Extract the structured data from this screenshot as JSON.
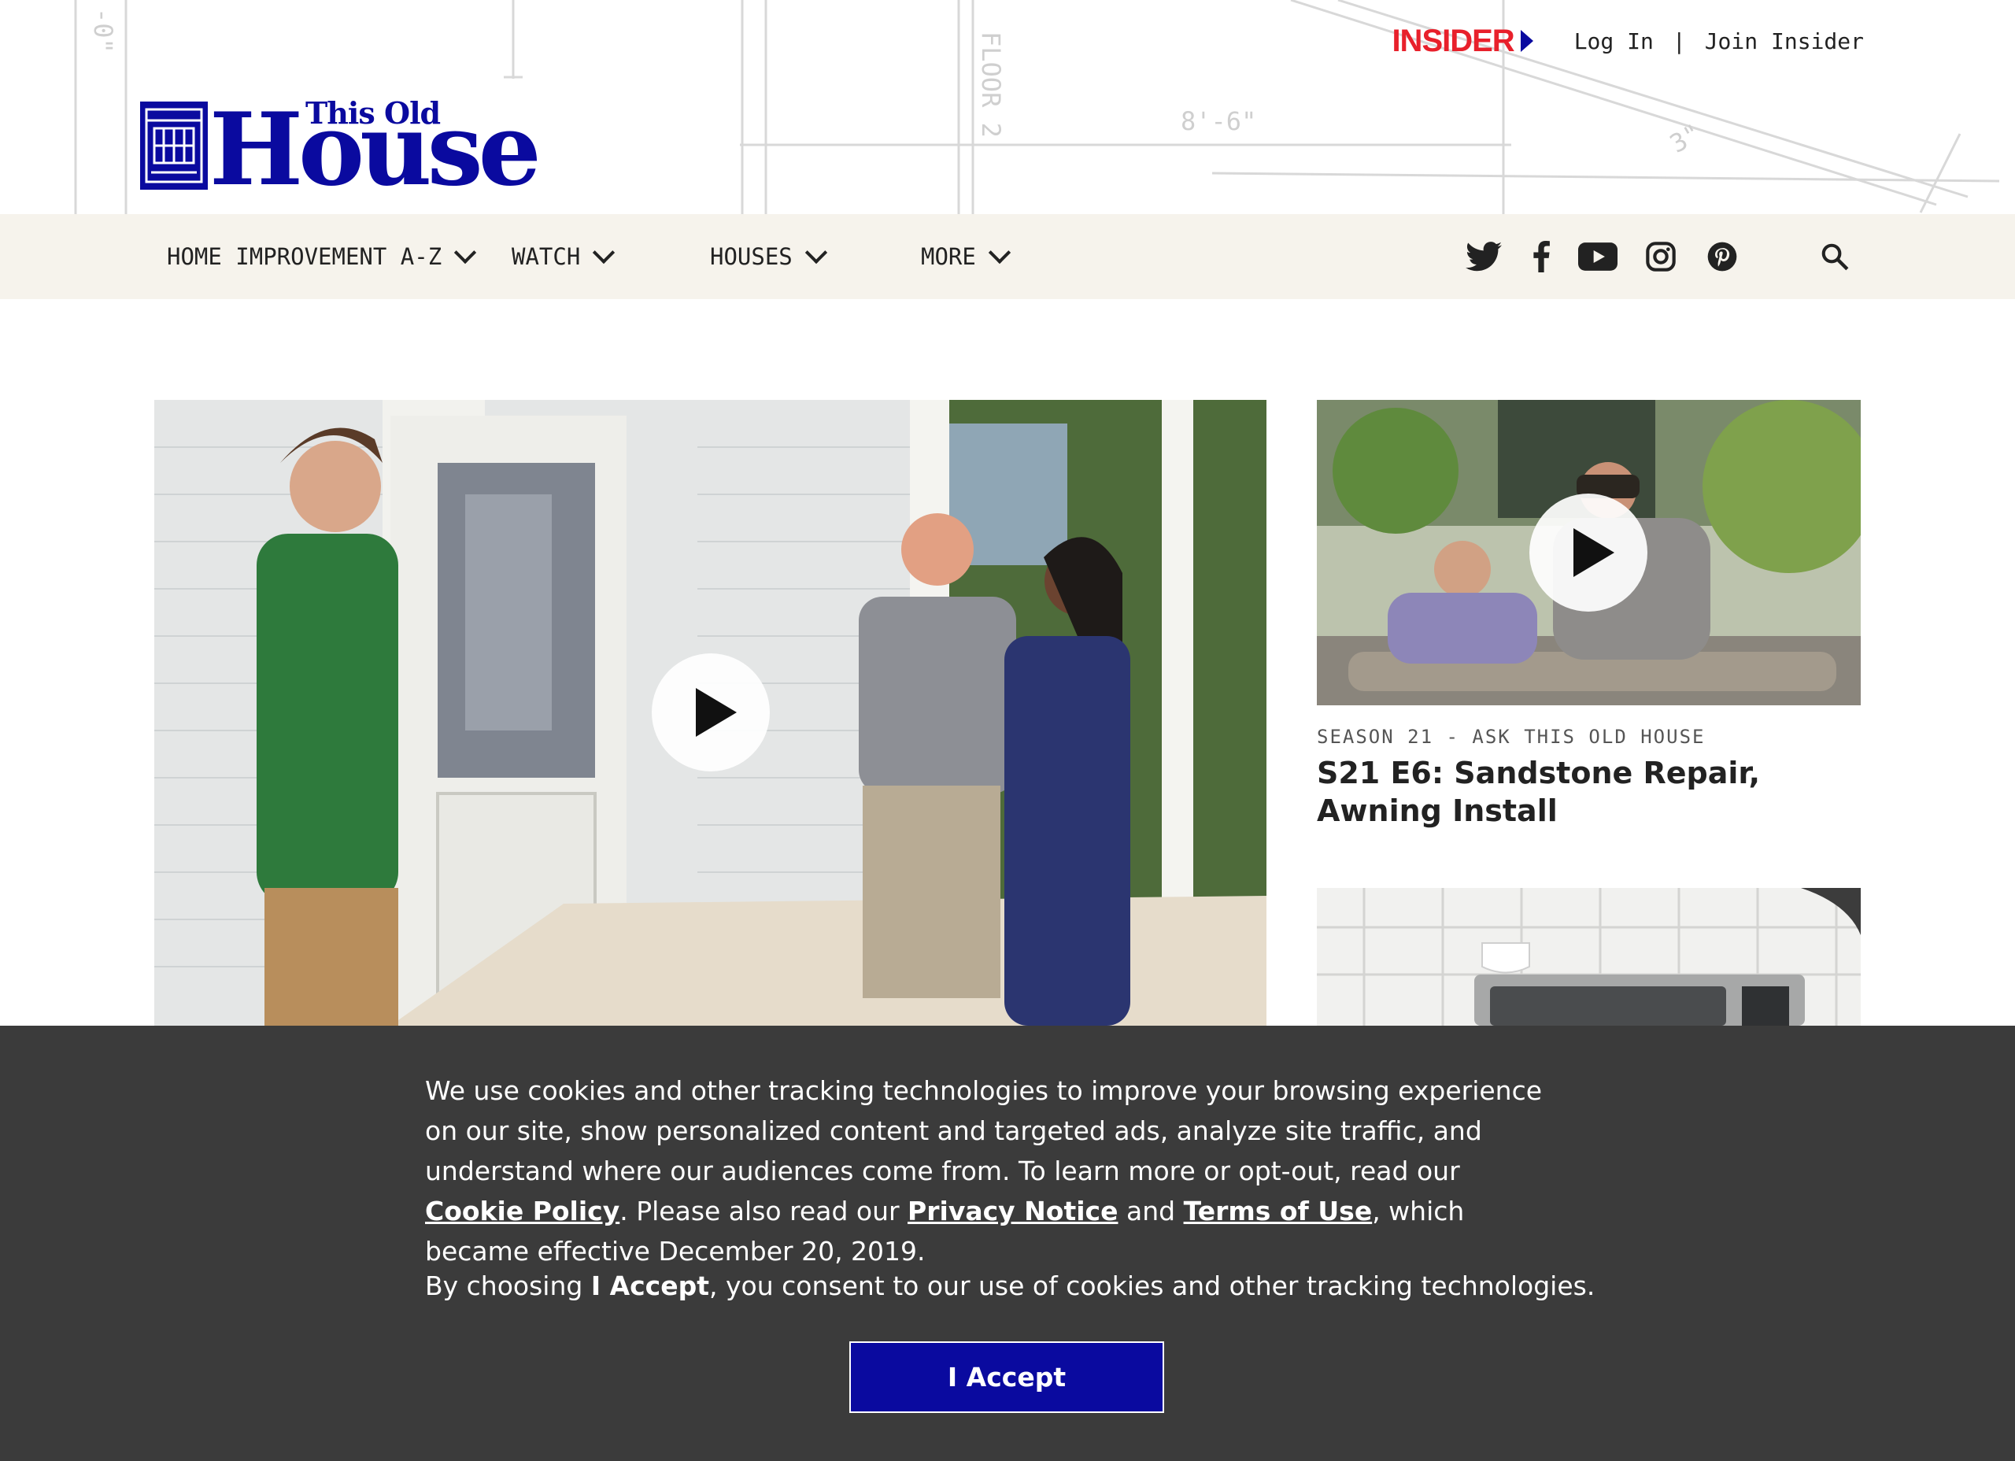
{
  "header": {
    "logo_small": "This Old",
    "logo_big": "House",
    "insider_label": "INSIDER",
    "login_label": "Log In",
    "separator": "|",
    "join_label": "Join Insider"
  },
  "nav": {
    "items": [
      {
        "label": "HOME IMPROVEMENT A-Z"
      },
      {
        "label": "WATCH"
      },
      {
        "label": "HOUSES"
      },
      {
        "label": "MORE"
      }
    ],
    "social_icons": [
      "twitter-icon",
      "facebook-icon",
      "youtube-icon",
      "instagram-icon",
      "pinterest-icon"
    ],
    "search_icon": "search-icon"
  },
  "cards": [
    {
      "kicker": "SEASON 21 - ASK THIS OLD HOUSE",
      "title": "S21 E6: Sandstone Repair, Awning Install"
    }
  ],
  "cookie": {
    "text_1": "We use cookies and other tracking technologies to improve your browsing experience on our site, show personalized content and targeted ads, analyze site traffic, and understand where our audiences come from. To learn more or opt-out, read our ",
    "cookie_policy_link": "Cookie Policy",
    "text_2": ". Please also read our ",
    "privacy_link": "Privacy Notice",
    "text_3": " and ",
    "terms_link": "Terms of Use",
    "text_4": ", which became effective December 20, 2019.",
    "consent_prefix": "By choosing ",
    "consent_bold": "I Accept",
    "consent_suffix": ", you consent to our use of cookies and other tracking technologies.",
    "accept_label": "I Accept"
  },
  "colors": {
    "brand_blue": "#0a0a9f",
    "insider_red": "#e8202b",
    "nav_bg": "#f6f3ec",
    "cookie_bg": "#3b3b3b"
  }
}
